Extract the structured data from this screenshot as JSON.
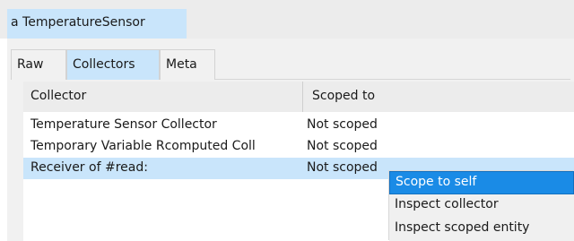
{
  "window": {
    "title": "a TemperatureSensor"
  },
  "tabs": [
    {
      "label": "Raw",
      "active": false
    },
    {
      "label": "Collectors",
      "active": true
    },
    {
      "label": "Meta",
      "active": false
    }
  ],
  "table": {
    "columns": [
      "Collector",
      "Scoped to"
    ],
    "rows": [
      {
        "collector": "Temperature Sensor Collector",
        "scoped_to": "Not scoped",
        "selected": false
      },
      {
        "collector": "Temporary Variable Rcomputed Coll",
        "scoped_to": "Not scoped",
        "selected": false
      },
      {
        "collector": "Receiver of #read:",
        "scoped_to": "Not scoped",
        "selected": true
      }
    ]
  },
  "context_menu": {
    "items": [
      {
        "label": "Scope to self",
        "highlighted": true
      },
      {
        "label": "Inspect collector",
        "highlighted": false
      },
      {
        "label": "Inspect scoped entity",
        "highlighted": false
      }
    ]
  },
  "colors": {
    "selection": "#c9e5fb",
    "menu_highlight": "#1a8be6",
    "panel_background": "#f1f1f1"
  }
}
